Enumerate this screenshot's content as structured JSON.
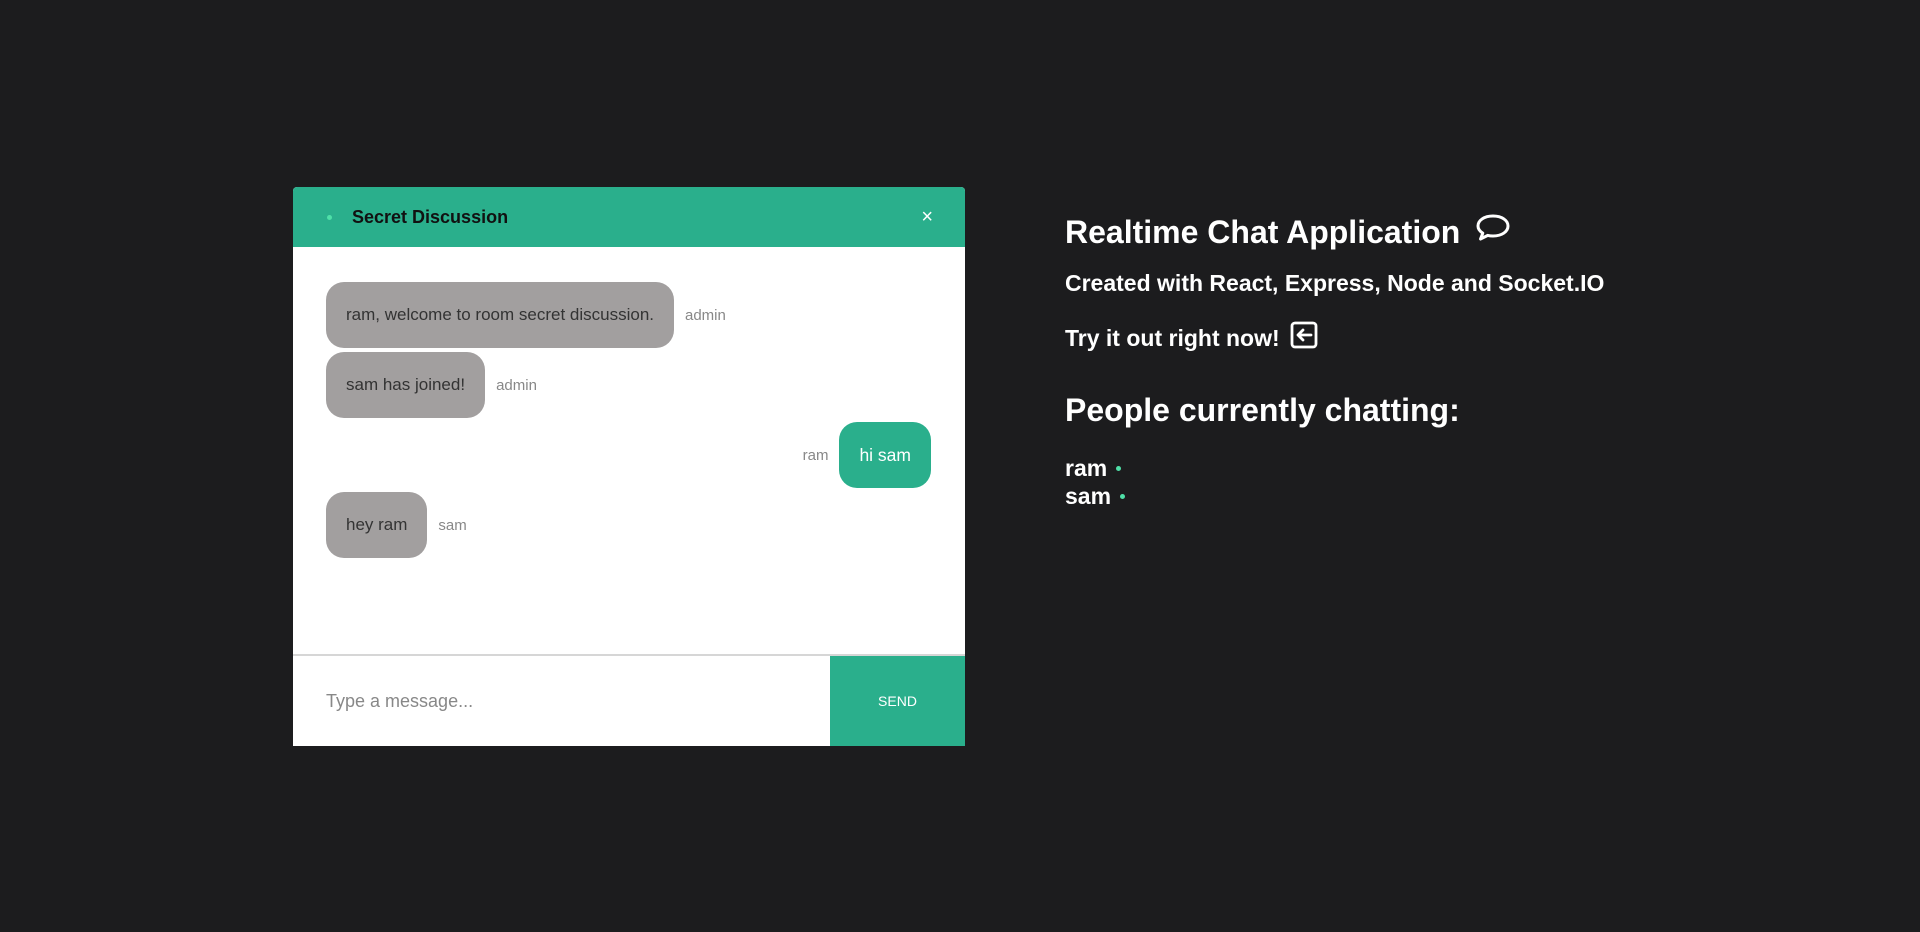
{
  "room": {
    "name": "Secret Discussion",
    "close_label": "×"
  },
  "messages": [
    {
      "text": "ram, welcome to room secret discussion.",
      "sender": "admin",
      "own": false
    },
    {
      "text": "sam has joined!",
      "sender": "admin",
      "own": false
    },
    {
      "text": "hi sam",
      "sender": "ram",
      "own": true
    },
    {
      "text": "hey ram",
      "sender": "sam",
      "own": false
    }
  ],
  "composer": {
    "placeholder": "Type a message...",
    "send_label": "SEND"
  },
  "info": {
    "title": "Realtime Chat Application",
    "title_icon": "speech-bubble-icon",
    "subtitle": "Created with React, Express, Node and Socket.IO",
    "try_text": "Try it out right now!",
    "try_icon": "enter-icon",
    "people_heading": "People currently chatting:",
    "people": [
      "ram",
      "sam"
    ]
  },
  "colors": {
    "accent": "#2aaf8c",
    "online": "#4fe0a8",
    "bubble_other": "#a29f9f",
    "background": "#1c1c1e"
  }
}
